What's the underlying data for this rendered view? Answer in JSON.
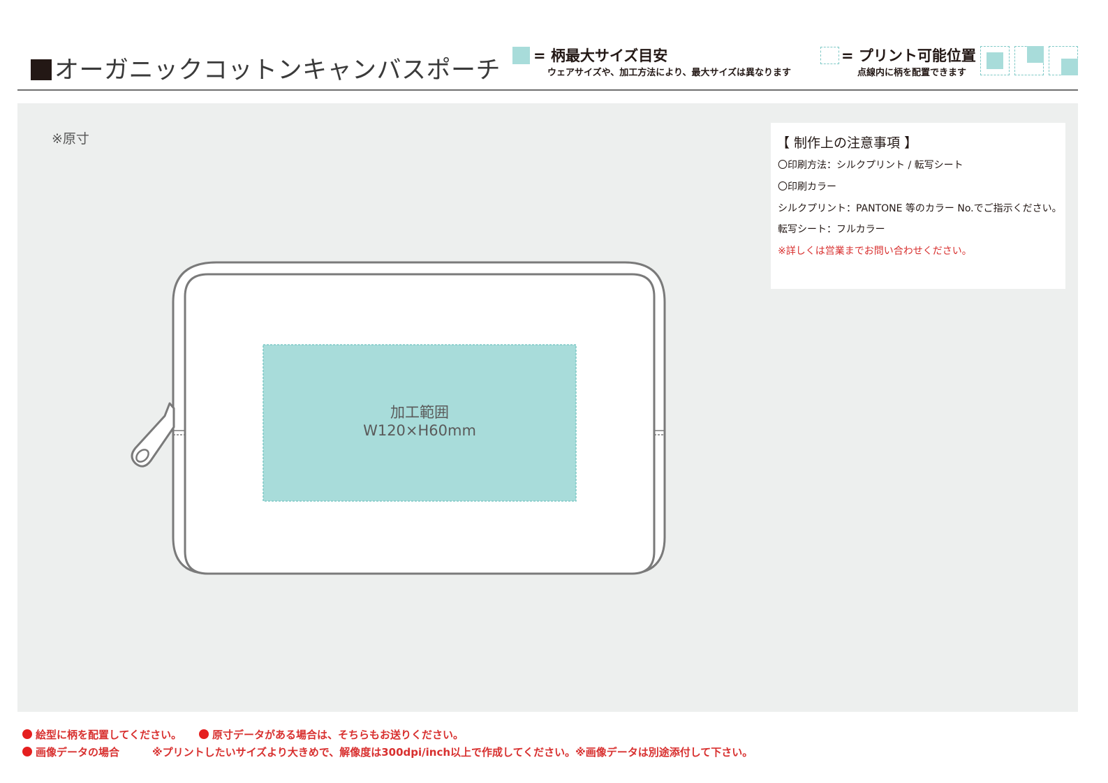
{
  "header": {
    "title": "オーガニックコットンキャンバスポーチ",
    "legend_max": {
      "title": "= 柄最大サイズ目安",
      "subtitle": "ウェアサイズや、加工方法により、最大サイズは異なります"
    },
    "legend_area": {
      "title": "= プリント可能位置",
      "subtitle": "点線内に柄を配置できます"
    }
  },
  "canvas": {
    "scale_note": "※原寸",
    "print_area": {
      "label": "加工範囲",
      "size": "W120×H60mm"
    }
  },
  "notes": {
    "title": "【 制作上の注意事項 】",
    "lines": [
      "〇印刷方法：シルクプリント / 転写シート",
      "〇印刷カラー",
      "シルクプリント：PANTONE 等のカラー No.でご指示ください。",
      "転写シート：フルカラー"
    ],
    "warning": "※詳しくは営業までお問い合わせください。"
  },
  "footer": {
    "item1": "絵型に柄を配置してください。",
    "item2": "原寸データがある場合は、そちらもお送りください。",
    "item3_label": "画像データの場合",
    "item3_text": "※プリントしたいサイズより大きめで、解像度は300dpi/inch以上で作成してください。※画像データは別途添付して下さい。"
  },
  "colors": {
    "print_area_fill": "#a8dcda",
    "print_area_border": "#7ec9c6",
    "accent_red": "#d8302f",
    "background_panel": "#edefee"
  }
}
